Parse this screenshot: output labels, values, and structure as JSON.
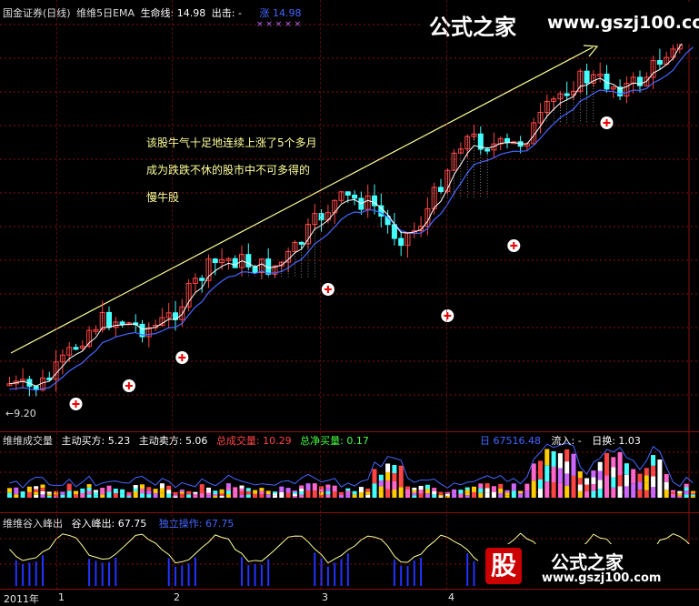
{
  "main_panel": {
    "title": "国金证券(日线)",
    "indicator": "维维5日EMA",
    "life_line_label": "生命线:",
    "life_line_value": "14.98",
    "exit_label": "出击:",
    "exit_value": "-",
    "buy_label": "涨",
    "buy_value": "14.98",
    "markers": "× ×          × ×    ×",
    "low_label": "9.20",
    "annotation_lines": [
      "该股牛气十足地连续上涨了5个多月",
      "成为跌跌不休的股市中不可多得的",
      "慢牛股"
    ],
    "watermark": "公式之家",
    "watermark_url": "www.gszj100.com"
  },
  "volume_panel": {
    "name": "维维成交量",
    "active_buy_label": "主动买方:",
    "active_buy_value": "5.23",
    "active_sell_label": "主动卖方:",
    "active_sell_value": "5.06",
    "total_volume_label": "总成交量:",
    "total_volume_value": "10.29",
    "net_buy_label": "总净买量:",
    "net_buy_value": "0.17",
    "day_label": "日",
    "day_value": "67516.48",
    "inflow_label": "流入:",
    "inflow_value": "-",
    "turnover_label": "日换:",
    "turnover_value": "1.03"
  },
  "peak_panel": {
    "name": "维维谷入峰出",
    "value_label": "谷入峰出:",
    "value": "67.75",
    "sub_label": "独立操作:",
    "sub_value": "67.75"
  },
  "bottom_logo": {
    "glyph": "股",
    "brand": "公式之家",
    "url": "www.gszj100.com"
  },
  "date_axis": [
    "2011年",
    "1",
    "2",
    "3",
    "4"
  ],
  "colors": {
    "up": "#ff4444",
    "down": "#44ffff",
    "line": "#ffff99",
    "ema": "#4466ff",
    "grid": "#8a1010",
    "purple": "#cc66ff"
  }
}
